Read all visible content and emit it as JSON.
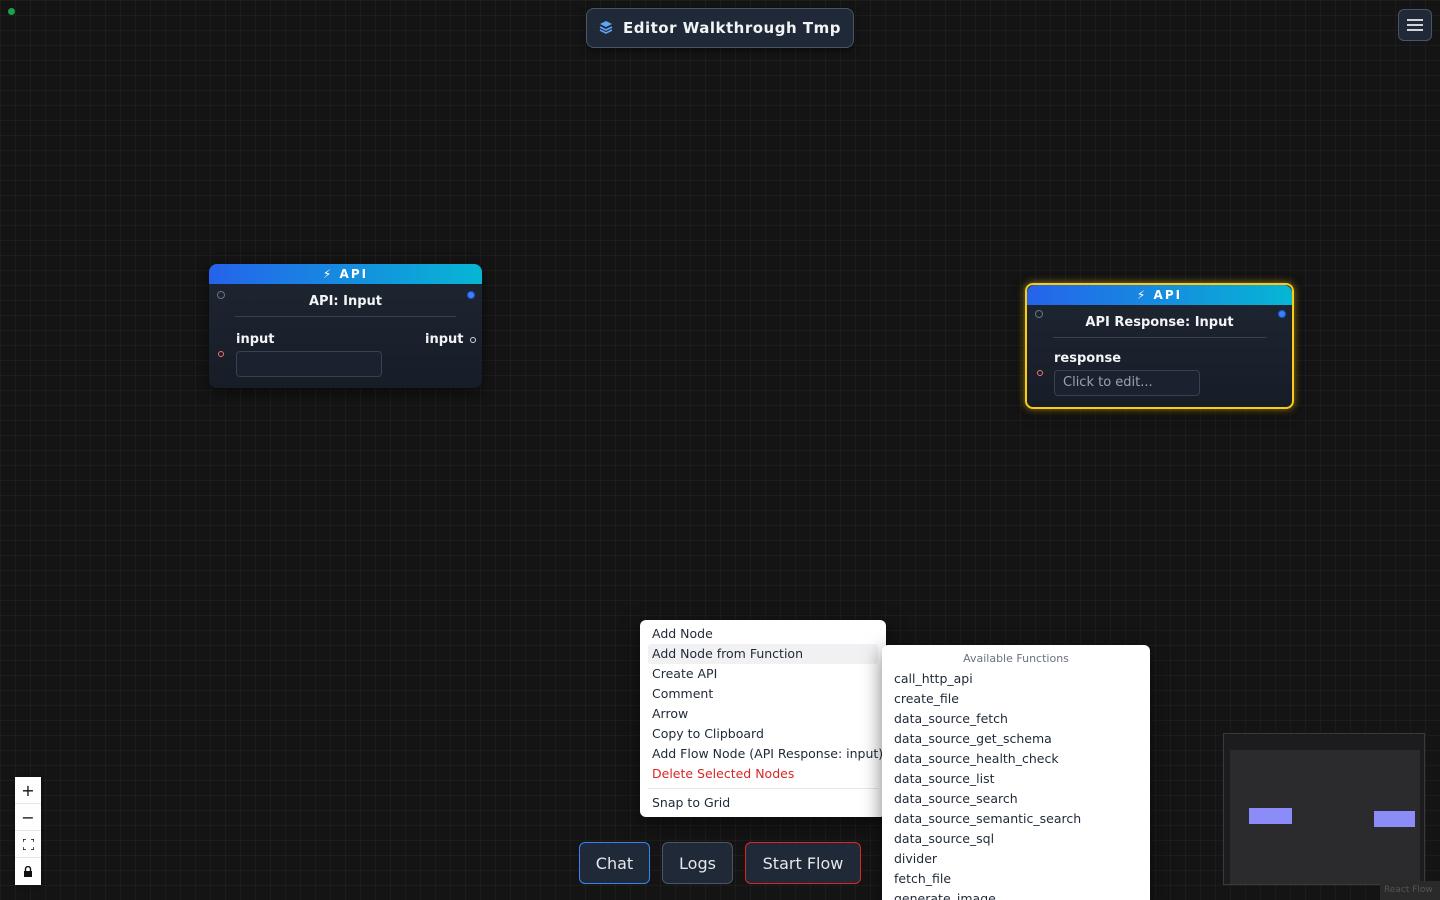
{
  "header": {
    "title": "Editor Walkthrough Tmp"
  },
  "nodes": {
    "api_input": {
      "badge": "⚡ API",
      "title": "API: Input",
      "field_label": "input",
      "output_label": "input",
      "field_value": ""
    },
    "api_response": {
      "badge": "⚡ API",
      "title": "API Response: Input",
      "field_label": "response",
      "field_placeholder": "Click to edit..."
    }
  },
  "context_menu": {
    "items": [
      "Add Node",
      "Add Node from Function",
      "Create API",
      "Comment",
      "Arrow",
      "Copy to Clipboard",
      "Add Flow Node (API Response: input)",
      "Delete Selected Nodes",
      "Snap to Grid"
    ]
  },
  "functions_panel": {
    "header": "Available Functions",
    "items": [
      "call_http_api",
      "create_file",
      "data_source_fetch",
      "data_source_get_schema",
      "data_source_health_check",
      "data_source_list",
      "data_source_search",
      "data_source_semantic_search",
      "data_source_sql",
      "divider",
      "fetch_file",
      "generate_image"
    ]
  },
  "bottom_bar": {
    "chat": "Chat",
    "logs": "Logs",
    "start_flow": "Start Flow"
  },
  "zoom_controls": {
    "zoom_in": "+",
    "zoom_out": "−"
  },
  "attribution": "React Flow",
  "colors": {
    "accent_blue": "#2563eb",
    "accent_cyan": "#06b6d4",
    "selected": "#facc15",
    "danger": "#dc2626",
    "start_flow_border": "#dc2626",
    "chat_border": "#3b82f6"
  }
}
